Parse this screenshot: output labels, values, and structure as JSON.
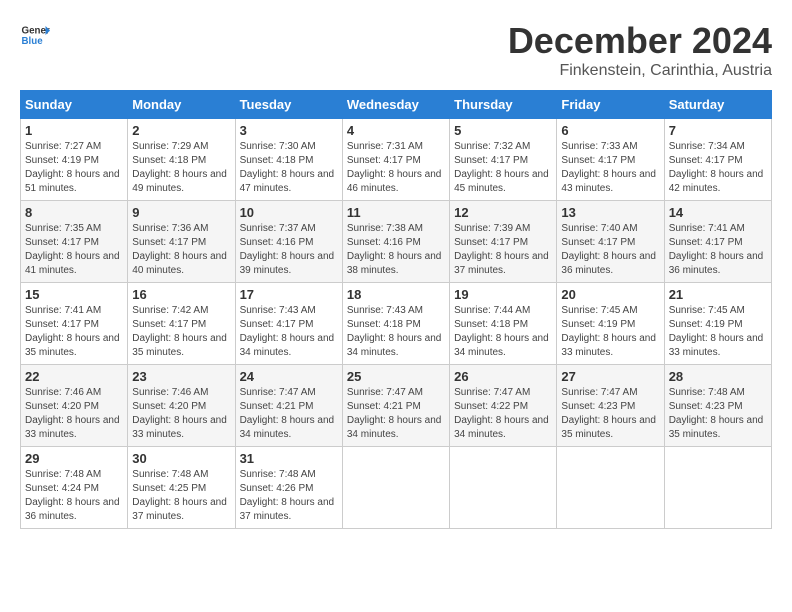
{
  "logo": {
    "general": "General",
    "blue": "Blue"
  },
  "title": "December 2024",
  "subtitle": "Finkenstein, Carinthia, Austria",
  "days_of_week": [
    "Sunday",
    "Monday",
    "Tuesday",
    "Wednesday",
    "Thursday",
    "Friday",
    "Saturday"
  ],
  "weeks": [
    [
      {
        "day": "1",
        "sunrise": "7:27 AM",
        "sunset": "4:19 PM",
        "daylight": "8 hours and 51 minutes."
      },
      {
        "day": "2",
        "sunrise": "7:29 AM",
        "sunset": "4:18 PM",
        "daylight": "8 hours and 49 minutes."
      },
      {
        "day": "3",
        "sunrise": "7:30 AM",
        "sunset": "4:18 PM",
        "daylight": "8 hours and 47 minutes."
      },
      {
        "day": "4",
        "sunrise": "7:31 AM",
        "sunset": "4:17 PM",
        "daylight": "8 hours and 46 minutes."
      },
      {
        "day": "5",
        "sunrise": "7:32 AM",
        "sunset": "4:17 PM",
        "daylight": "8 hours and 45 minutes."
      },
      {
        "day": "6",
        "sunrise": "7:33 AM",
        "sunset": "4:17 PM",
        "daylight": "8 hours and 43 minutes."
      },
      {
        "day": "7",
        "sunrise": "7:34 AM",
        "sunset": "4:17 PM",
        "daylight": "8 hours and 42 minutes."
      }
    ],
    [
      {
        "day": "8",
        "sunrise": "7:35 AM",
        "sunset": "4:17 PM",
        "daylight": "8 hours and 41 minutes."
      },
      {
        "day": "9",
        "sunrise": "7:36 AM",
        "sunset": "4:17 PM",
        "daylight": "8 hours and 40 minutes."
      },
      {
        "day": "10",
        "sunrise": "7:37 AM",
        "sunset": "4:16 PM",
        "daylight": "8 hours and 39 minutes."
      },
      {
        "day": "11",
        "sunrise": "7:38 AM",
        "sunset": "4:16 PM",
        "daylight": "8 hours and 38 minutes."
      },
      {
        "day": "12",
        "sunrise": "7:39 AM",
        "sunset": "4:17 PM",
        "daylight": "8 hours and 37 minutes."
      },
      {
        "day": "13",
        "sunrise": "7:40 AM",
        "sunset": "4:17 PM",
        "daylight": "8 hours and 36 minutes."
      },
      {
        "day": "14",
        "sunrise": "7:41 AM",
        "sunset": "4:17 PM",
        "daylight": "8 hours and 36 minutes."
      }
    ],
    [
      {
        "day": "15",
        "sunrise": "7:41 AM",
        "sunset": "4:17 PM",
        "daylight": "8 hours and 35 minutes."
      },
      {
        "day": "16",
        "sunrise": "7:42 AM",
        "sunset": "4:17 PM",
        "daylight": "8 hours and 35 minutes."
      },
      {
        "day": "17",
        "sunrise": "7:43 AM",
        "sunset": "4:17 PM",
        "daylight": "8 hours and 34 minutes."
      },
      {
        "day": "18",
        "sunrise": "7:43 AM",
        "sunset": "4:18 PM",
        "daylight": "8 hours and 34 minutes."
      },
      {
        "day": "19",
        "sunrise": "7:44 AM",
        "sunset": "4:18 PM",
        "daylight": "8 hours and 34 minutes."
      },
      {
        "day": "20",
        "sunrise": "7:45 AM",
        "sunset": "4:19 PM",
        "daylight": "8 hours and 33 minutes."
      },
      {
        "day": "21",
        "sunrise": "7:45 AM",
        "sunset": "4:19 PM",
        "daylight": "8 hours and 33 minutes."
      }
    ],
    [
      {
        "day": "22",
        "sunrise": "7:46 AM",
        "sunset": "4:20 PM",
        "daylight": "8 hours and 33 minutes."
      },
      {
        "day": "23",
        "sunrise": "7:46 AM",
        "sunset": "4:20 PM",
        "daylight": "8 hours and 33 minutes."
      },
      {
        "day": "24",
        "sunrise": "7:47 AM",
        "sunset": "4:21 PM",
        "daylight": "8 hours and 34 minutes."
      },
      {
        "day": "25",
        "sunrise": "7:47 AM",
        "sunset": "4:21 PM",
        "daylight": "8 hours and 34 minutes."
      },
      {
        "day": "26",
        "sunrise": "7:47 AM",
        "sunset": "4:22 PM",
        "daylight": "8 hours and 34 minutes."
      },
      {
        "day": "27",
        "sunrise": "7:47 AM",
        "sunset": "4:23 PM",
        "daylight": "8 hours and 35 minutes."
      },
      {
        "day": "28",
        "sunrise": "7:48 AM",
        "sunset": "4:23 PM",
        "daylight": "8 hours and 35 minutes."
      }
    ],
    [
      {
        "day": "29",
        "sunrise": "7:48 AM",
        "sunset": "4:24 PM",
        "daylight": "8 hours and 36 minutes."
      },
      {
        "day": "30",
        "sunrise": "7:48 AM",
        "sunset": "4:25 PM",
        "daylight": "8 hours and 37 minutes."
      },
      {
        "day": "31",
        "sunrise": "7:48 AM",
        "sunset": "4:26 PM",
        "daylight": "8 hours and 37 minutes."
      },
      null,
      null,
      null,
      null
    ]
  ],
  "labels": {
    "sunrise": "Sunrise:",
    "sunset": "Sunset:",
    "daylight": "Daylight:"
  },
  "accent_color": "#2a7fd4"
}
